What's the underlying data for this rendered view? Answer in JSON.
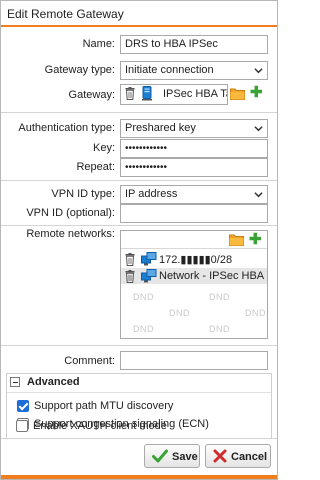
{
  "window": {
    "title": "Edit Remote Gateway"
  },
  "form": {
    "name_label": "Name:",
    "name_value": "DRS to HBA IPSec",
    "gateway_type_label": "Gateway type:",
    "gateway_type_value": "Initiate connection",
    "gateway_label": "Gateway:",
    "gateway_value": "IPSec HBA Ta",
    "auth_type_label": "Authentication type:",
    "auth_type_value": "Preshared key",
    "key_label": "Key:",
    "key_value": "••••••••••••",
    "repeat_label": "Repeat:",
    "repeat_value": "••••••••••••",
    "vpn_id_type_label": "VPN ID type:",
    "vpn_id_type_value": "IP address",
    "vpn_id_label": "VPN ID (optional):",
    "vpn_id_value": "",
    "remote_networks_label": "Remote networks:",
    "remote_networks": [
      {
        "text": "172.▮▮▮▮▮0/28",
        "selected": false
      },
      {
        "text": "Network - IPSec HBA",
        "selected": true
      }
    ],
    "dnd_text": "DND",
    "comment_label": "Comment:",
    "comment_value": ""
  },
  "advanced": {
    "title": "Advanced",
    "options": [
      {
        "label": "Support path MTU discovery",
        "checked": true
      },
      {
        "label": "Support congestion signaling (ECN)",
        "checked": false
      }
    ],
    "xauth_label": "Enable XAUTH client mode",
    "xauth_checked": false
  },
  "buttons": {
    "save": "Save",
    "cancel": "Cancel"
  },
  "colors": {
    "accent": "#f07d1e",
    "add_green": "#3aa335",
    "cancel_red": "#d12a2a",
    "checkbox_blue": "#1e6fd9"
  },
  "icons": {
    "trash": "trash-icon",
    "gateway_host": "host-icon",
    "network": "network-icon",
    "folder": "folder-icon",
    "add": "plus-icon",
    "save": "checkmark-icon",
    "cancel": "x-icon",
    "collapse": "minus-icon"
  }
}
